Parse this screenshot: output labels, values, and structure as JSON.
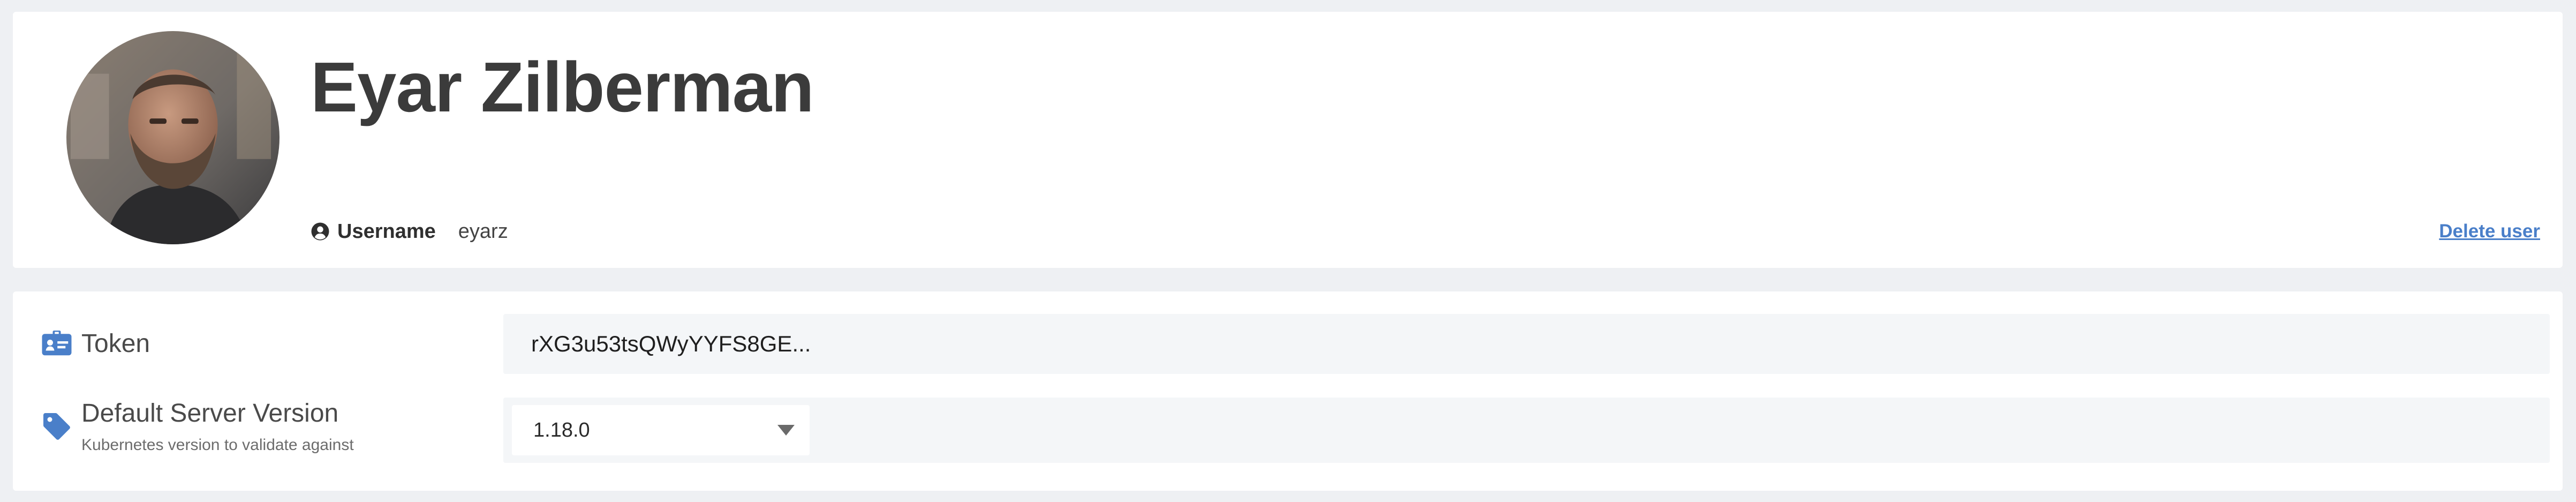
{
  "profile": {
    "display_name": "Eyar Zilberman",
    "username_label": "Username",
    "username_value": "eyarz",
    "delete_link": "Delete user"
  },
  "settings": {
    "token": {
      "label": "Token",
      "value": "rXG3u53tsQWyYYFS8GE..."
    },
    "server_version": {
      "label": "Default Server Version",
      "description": "Kubernetes version to validate against",
      "selected": "1.18.0"
    }
  },
  "icons": {
    "username": "user-circle-icon",
    "token": "id-card-icon",
    "server_version": "tag-icon",
    "select": "chevron-down-icon"
  },
  "colors": {
    "accent": "#4a7fc9",
    "page_background": "#eef0f3",
    "card_background": "#ffffff",
    "value_background": "#f4f6f8",
    "name_text": "#3b3b3b"
  }
}
